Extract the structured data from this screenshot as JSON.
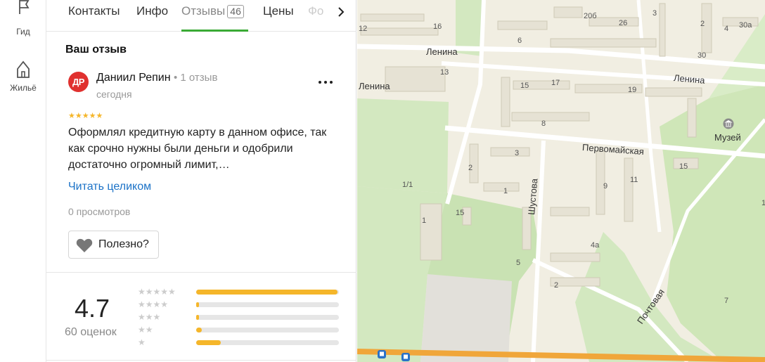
{
  "rail": {
    "items": [
      {
        "label": "Гид",
        "icon": "flag-icon"
      },
      {
        "label": "Жильё",
        "icon": "house-icon"
      }
    ]
  },
  "tabs": [
    {
      "label": "Контакты"
    },
    {
      "label": "Инфо"
    },
    {
      "label": "Отзывы",
      "count": "46",
      "active": true
    },
    {
      "label": "Цены"
    },
    {
      "label": "Фо"
    }
  ],
  "review_section": {
    "title": "Ваш отзыв",
    "avatar_initials": "ДР",
    "author": "Даниил Репин",
    "author_meta": "• 1 отзыв",
    "date": "сегодня",
    "stars": "★★★★★",
    "rating": 5,
    "text": "Оформлял кредитную карту в данном офисе, так как срочно нужны были деньги и одобрили достаточно огромный лимит,…",
    "read_more": "Читать целиком",
    "views": "0 просмотров",
    "useful_label": "Полезно?"
  },
  "rating_summary": {
    "value": "4.7",
    "count_label": "60 оценок",
    "distribution": [
      {
        "stars": "★★★★★",
        "fraction": 0.99
      },
      {
        "stars": "★★★★",
        "fraction": 0.02
      },
      {
        "stars": "★★★",
        "fraction": 0.02
      },
      {
        "stars": "★★",
        "fraction": 0.04
      },
      {
        "stars": "★",
        "fraction": 0.17
      }
    ]
  },
  "map": {
    "streets": [
      "Ленина",
      "Ленина",
      "Ленина",
      "Первомайская",
      "Шустова",
      "Почтовая"
    ],
    "poi": [
      "Музей"
    ],
    "house_numbers": [
      "12",
      "16",
      "6",
      "20б",
      "26",
      "2",
      "4",
      "3",
      "30",
      "30а",
      "13",
      "15",
      "17",
      "19",
      "8",
      "3",
      "2",
      "1",
      "1/1",
      "15",
      "1",
      "9",
      "11",
      "15",
      "4а",
      "5",
      "2",
      "7",
      "1"
    ]
  },
  "colors": {
    "accent": "#3aaa35",
    "star": "#f5b62a",
    "link": "#1b72c7",
    "avatar": "#e0312f",
    "map_background": "#f1eee2",
    "park": "#d3e8c0"
  }
}
